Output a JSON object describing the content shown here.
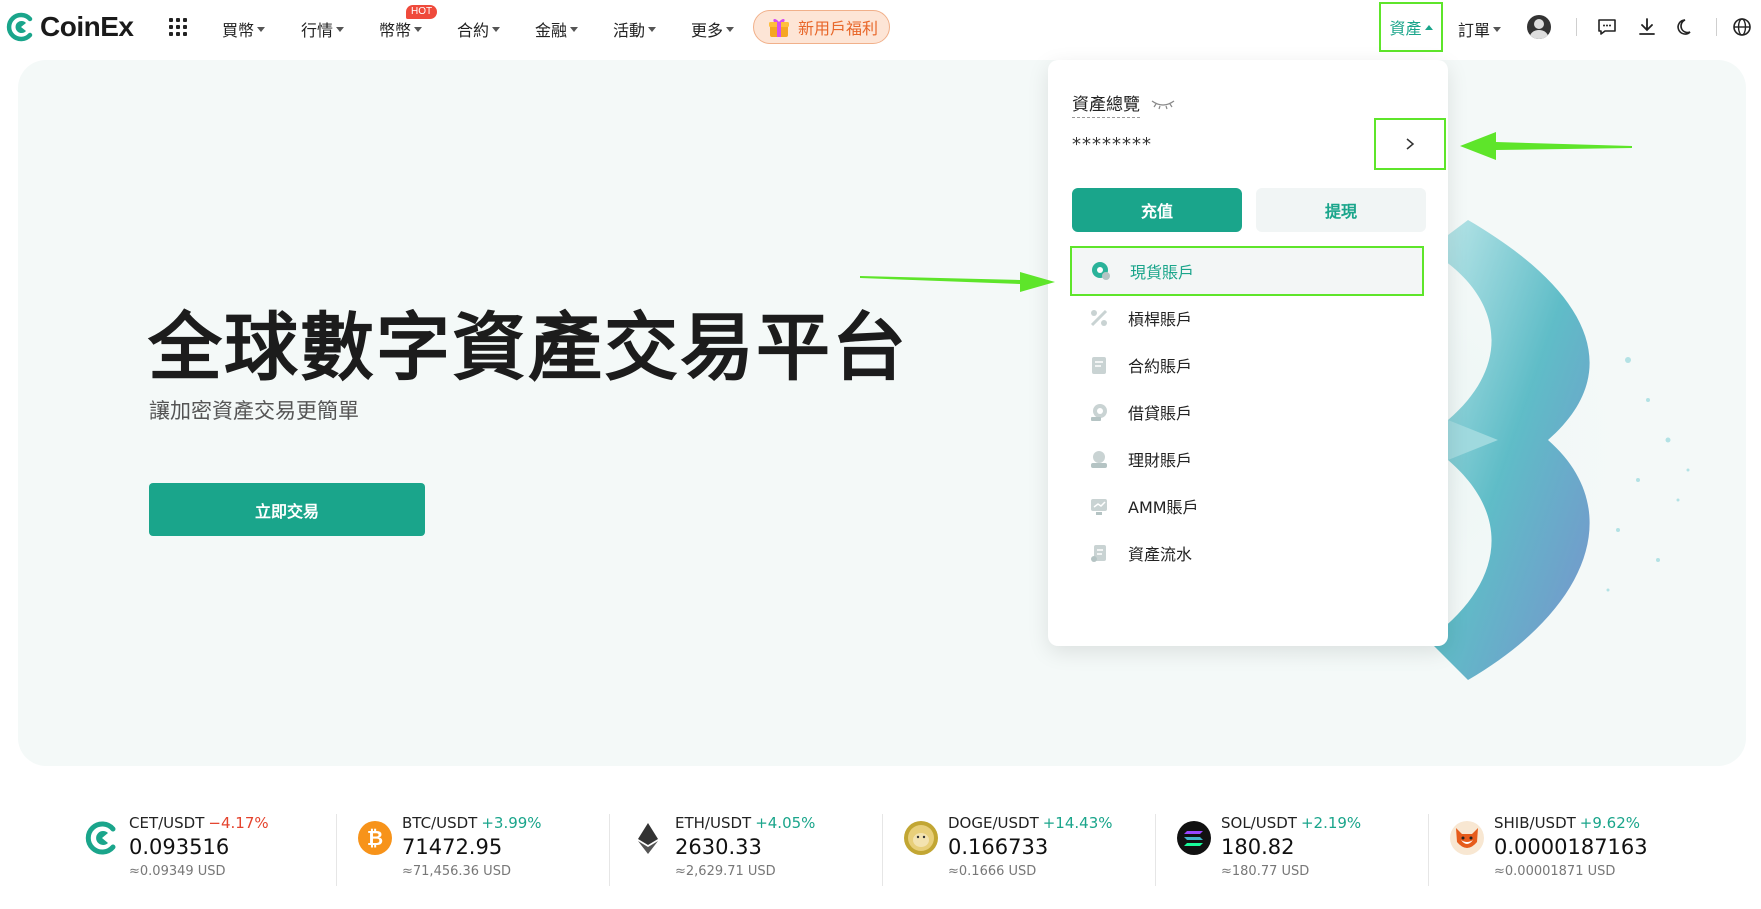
{
  "brand": {
    "name": "CoinEx",
    "color": "#1aa58b"
  },
  "nav": {
    "items": [
      {
        "label": "買幣"
      },
      {
        "label": "行情"
      },
      {
        "label": "幣幣"
      },
      {
        "label": "合約"
      },
      {
        "label": "金融"
      },
      {
        "label": "活動"
      },
      {
        "label": "更多"
      }
    ],
    "hot_badge": "HOT",
    "promo": "新用戶福利",
    "assets": "資產",
    "orders": "訂單"
  },
  "hero": {
    "title": "全球數字資產交易平台",
    "subtitle": "讓加密資產交易更簡單",
    "cta": "立即交易"
  },
  "dropdown": {
    "title": "資產總覽",
    "balance": "********",
    "deposit": "充值",
    "withdraw": "提現",
    "items": [
      {
        "label": "現貨賬戶",
        "icon": "spot-account-icon"
      },
      {
        "label": "槓桿賬戶",
        "icon": "margin-account-icon"
      },
      {
        "label": "合約賬戶",
        "icon": "futures-account-icon"
      },
      {
        "label": "借貸賬戶",
        "icon": "loan-account-icon"
      },
      {
        "label": "理財賬戶",
        "icon": "financial-account-icon"
      },
      {
        "label": "AMM賬戶",
        "icon": "amm-account-icon"
      },
      {
        "label": "資產流水",
        "icon": "asset-history-icon"
      }
    ]
  },
  "ticker": [
    {
      "pair": "CET/USDT",
      "change": "−4.17%",
      "direction": "down",
      "price": "0.093516",
      "usd": "≈0.09349 USD"
    },
    {
      "pair": "BTC/USDT",
      "change": "+3.99%",
      "direction": "up",
      "price": "71472.95",
      "usd": "≈71,456.36 USD"
    },
    {
      "pair": "ETH/USDT",
      "change": "+4.05%",
      "direction": "up",
      "price": "2630.33",
      "usd": "≈2,629.71 USD"
    },
    {
      "pair": "DOGE/USDT",
      "change": "+14.43%",
      "direction": "up",
      "price": "0.166733",
      "usd": "≈0.1666 USD"
    },
    {
      "pair": "SOL/USDT",
      "change": "+2.19%",
      "direction": "up",
      "price": "180.82",
      "usd": "≈180.77 USD"
    },
    {
      "pair": "SHIB/USDT",
      "change": "+9.62%",
      "direction": "up",
      "price": "0.0000187163",
      "usd": "≈0.00001871 USD"
    }
  ],
  "colors": {
    "accent": "#1aa58b",
    "highlight": "#5ee52a",
    "down": "#e4432d"
  }
}
